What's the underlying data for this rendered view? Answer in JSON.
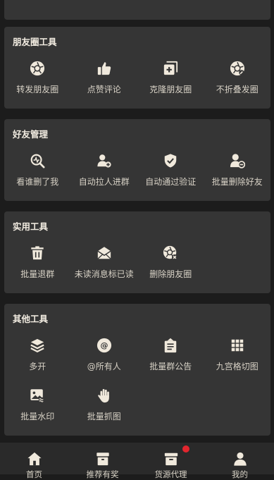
{
  "colors": {
    "background": "#1c1c1c",
    "card": "#353535",
    "icon": "#f0e9dc",
    "text": "#d8d2c6",
    "badge": "#e2262e"
  },
  "top_partial": {
    "labels": [
      "",
      "",
      "",
      ""
    ]
  },
  "moments": {
    "title": "朋友圈工具",
    "items": [
      {
        "label": "转发朋友圈",
        "icon": "aperture-icon"
      },
      {
        "label": "点赞评论",
        "icon": "thumbs-up-icon"
      },
      {
        "label": "克隆朋友圈",
        "icon": "clone-plus-icon"
      },
      {
        "label": "不折叠发圈",
        "icon": "aperture-edit-icon"
      }
    ]
  },
  "friends": {
    "title": "好友管理",
    "items": [
      {
        "label": "看谁删了我",
        "icon": "detect-icon"
      },
      {
        "label": "自动拉人进群",
        "icon": "group-add-icon"
      },
      {
        "label": "自动通过验证",
        "icon": "shield-check-icon"
      },
      {
        "label": "批量删除好友",
        "icon": "user-remove-icon"
      }
    ]
  },
  "utility": {
    "title": "实用工具",
    "items": [
      {
        "label": "批量退群",
        "icon": "trash-icon"
      },
      {
        "label": "未读消息标已读",
        "icon": "mail-open-icon"
      },
      {
        "label": "删除朋友圈",
        "icon": "aperture-delete-icon"
      }
    ]
  },
  "other": {
    "title": "其他工具",
    "items": [
      {
        "label": "多开",
        "icon": "layers-icon"
      },
      {
        "label": "@所有人",
        "icon": "at-icon"
      },
      {
        "label": "批量群公告",
        "icon": "notice-board-icon"
      },
      {
        "label": "九宫格切图",
        "icon": "grid-icon"
      },
      {
        "label": "批量水印",
        "icon": "image-watermark-icon"
      },
      {
        "label": "批量抓图",
        "icon": "hand-icon"
      }
    ]
  },
  "tabbar": {
    "items": [
      {
        "label": "首页",
        "icon": "home-icon"
      },
      {
        "label": "推荐有奖",
        "icon": "gift-box-icon"
      },
      {
        "label": "货源代理",
        "icon": "inbox-icon"
      },
      {
        "label": "我的",
        "icon": "user-icon"
      }
    ]
  }
}
